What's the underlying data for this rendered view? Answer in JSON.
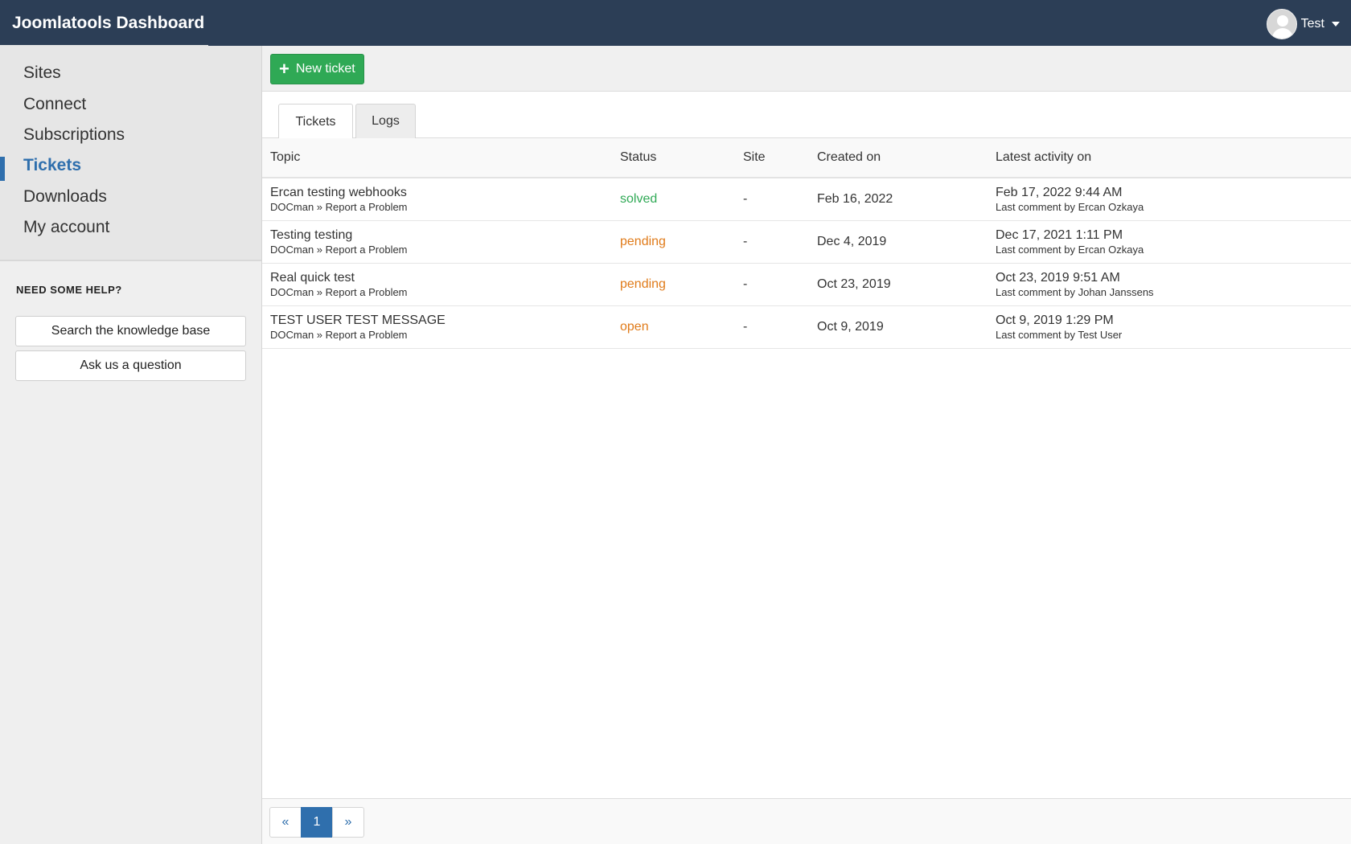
{
  "header": {
    "title": "Joomlatools Dashboard",
    "user_name": "Test"
  },
  "sidebar": {
    "items": [
      {
        "label": "Sites",
        "active": false
      },
      {
        "label": "Connect",
        "active": false
      },
      {
        "label": "Subscriptions",
        "active": false
      },
      {
        "label": "Tickets",
        "active": true
      },
      {
        "label": "Downloads",
        "active": false
      },
      {
        "label": "My account",
        "active": false
      }
    ],
    "help_title": "NEED SOME HELP?",
    "help_buttons": [
      "Search the knowledge base",
      "Ask us a question"
    ]
  },
  "toolbar": {
    "new_ticket_label": "New ticket"
  },
  "tabs": [
    "Tickets",
    "Logs"
  ],
  "table": {
    "columns": [
      "Topic",
      "Status",
      "Site",
      "Created on",
      "Latest activity on"
    ],
    "rows": [
      {
        "topic": "Ercan testing webhooks",
        "category": "DOCman » Report a Problem",
        "status": "solved",
        "site": "-",
        "created": "Feb 16, 2022",
        "activity": "Feb 17, 2022 9:44 AM",
        "last_comment": "Last comment by Ercan Ozkaya"
      },
      {
        "topic": "Testing testing",
        "category": "DOCman » Report a Problem",
        "status": "pending",
        "site": "-",
        "created": "Dec 4, 2019",
        "activity": "Dec 17, 2021 1:11 PM",
        "last_comment": "Last comment by Ercan Ozkaya"
      },
      {
        "topic": "Real quick test",
        "category": "DOCman » Report a Problem",
        "status": "pending",
        "site": "-",
        "created": "Oct 23, 2019",
        "activity": "Oct 23, 2019 9:51 AM",
        "last_comment": "Last comment by Johan Janssens"
      },
      {
        "topic": "TEST USER TEST MESSAGE",
        "category": "DOCman » Report a Problem",
        "status": "open",
        "site": "-",
        "created": "Oct 9, 2019",
        "activity": "Oct 9, 2019 1:29 PM",
        "last_comment": "Last comment by Test User"
      }
    ]
  },
  "pagination": {
    "prev": "«",
    "current": "1",
    "next": "»"
  },
  "colors": {
    "header_bg": "#2c3e56",
    "accent": "#2f6fad",
    "success": "#2fa955",
    "warning": "#e07b1a"
  }
}
